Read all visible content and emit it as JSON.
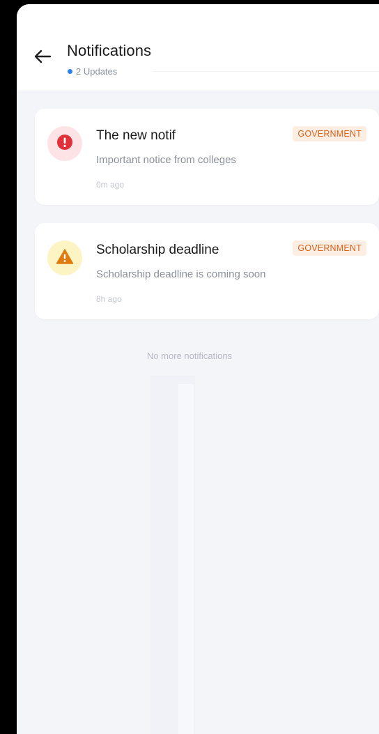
{
  "header": {
    "title": "Notifications",
    "updates": "2 Updates",
    "back_icon": "arrow-left-icon"
  },
  "notifications": [
    {
      "title": "The new notif",
      "tag": "GOVERNMENT",
      "description": "Important notice from colleges",
      "time": "0m ago",
      "icon": "alert-circle-icon"
    },
    {
      "title": "Scholarship deadline",
      "tag": "GOVERNMENT",
      "description": "Scholarship deadline is coming soon",
      "time": "8h ago",
      "icon": "warning-triangle-icon"
    }
  ],
  "footer": {
    "no_more": "No more notifications"
  },
  "colors": {
    "accent": "#2f7fe8",
    "alert_red": "#e0303a",
    "alert_bg": "#fde3e5",
    "warning_orange": "#e07b10",
    "warning_bg": "#fdf4c4",
    "tag_bg": "#fdeee4",
    "tag_text": "#d6621b",
    "page_bg": "#f4f5f9"
  }
}
